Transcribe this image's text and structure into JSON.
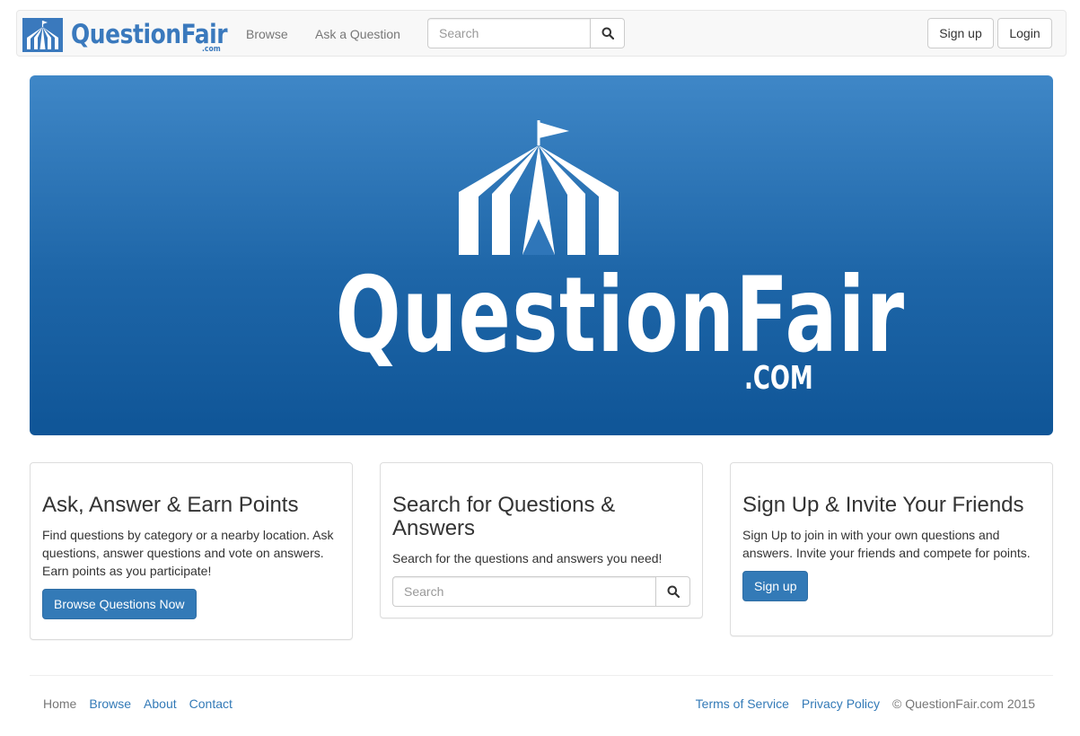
{
  "navbar": {
    "brand_name": "QuestionFair",
    "brand_dotcom": ".com",
    "links": [
      "Browse",
      "Ask a Question"
    ],
    "search_placeholder": "Search",
    "signup_label": "Sign up",
    "login_label": "Login"
  },
  "hero": {
    "title": "QuestionFair",
    "dotcom": ".COM"
  },
  "panels": [
    {
      "heading": "Ask, Answer & Earn Points",
      "text": "Find questions by category or a nearby location. Ask questions, answer questions and vote on answers. Earn points as you participate!",
      "button_label": "Browse Questions Now"
    },
    {
      "heading": "Search for Questions & Answers",
      "text": "Search for the questions and answers you need!",
      "search_placeholder": "Search"
    },
    {
      "heading": "Sign Up & Invite Your Friends",
      "text": "Sign Up to join in with your own questions and answers. Invite your friends and compete for points.",
      "button_label": "Sign up"
    }
  ],
  "footer": {
    "left_links": [
      "Home",
      "Browse",
      "About",
      "Contact"
    ],
    "right_links": [
      "Terms of Service",
      "Privacy Policy"
    ],
    "copyright": "© QuestionFair.com 2015"
  },
  "colors": {
    "brand": "#3a79bd",
    "primary": "#337ab7",
    "hero_top": "#3f87c7",
    "hero_bottom": "#0f5597",
    "navbar_bg": "#f8f8f8"
  },
  "icons": {
    "search": "search-icon",
    "logo": "tent-icon"
  }
}
